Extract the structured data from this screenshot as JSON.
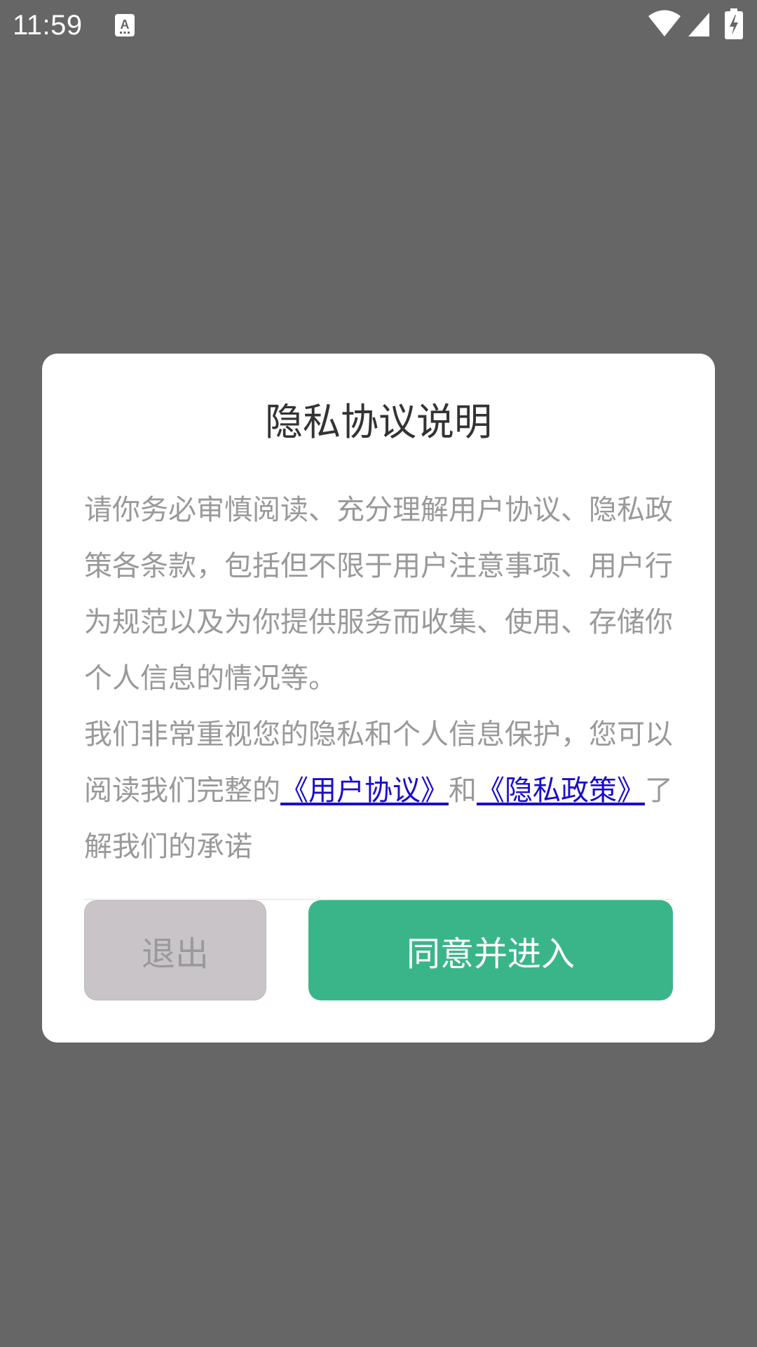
{
  "status_bar": {
    "time": "11:59",
    "notification_icon": "text-a-icon",
    "wifi_icon": "wifi-icon",
    "signal_icon": "cell-signal-icon",
    "battery_icon": "battery-charging-icon"
  },
  "dialog": {
    "title": "隐私协议说明",
    "paragraph1": "请你务必审慎阅读、充分理解用户协议、隐私政策各条款，包括但不限于用户注意事项、用户行为规范以及为你提供服务而收集、使用、存储你个人信息的情况等。",
    "paragraph2_prefix": "我们非常重视您的隐私和个人信息保护，您可以阅读我们完整的",
    "user_agreement_link": "《用户协议》",
    "connector": "和",
    "privacy_policy_link": "《隐私政策》",
    "paragraph2_suffix": "了解我们的承诺",
    "exit_button": "退出",
    "agree_button": "同意并进入"
  },
  "colors": {
    "overlay": "#666666",
    "accent": "#3ab58a",
    "link": "#1a0dcc",
    "exit_button_bg": "#c9c4c8"
  }
}
